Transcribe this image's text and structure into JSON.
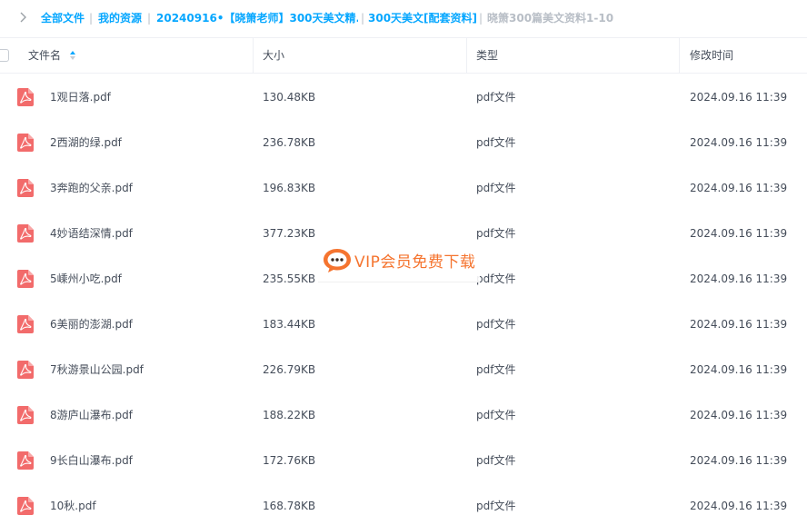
{
  "breadcrumb": {
    "items": [
      "全部文件",
      "我的资源",
      "20240916•【晓箫老师】300天美文精...",
      "300天美文[配套资料]"
    ],
    "current": "晓箫300篇美文资料1-10",
    "separator": "|"
  },
  "table": {
    "headers": {
      "name": "文件名",
      "size": "大小",
      "type": "类型",
      "modified": "修改时间"
    },
    "rows": [
      {
        "name": "1观日落.pdf",
        "size": "130.48KB",
        "type": "pdf文件",
        "modified": "2024.09.16 11:39"
      },
      {
        "name": "2西湖的绿.pdf",
        "size": "236.78KB",
        "type": "pdf文件",
        "modified": "2024.09.16 11:39"
      },
      {
        "name": "3奔跑的父亲.pdf",
        "size": "196.83KB",
        "type": "pdf文件",
        "modified": "2024.09.16 11:39"
      },
      {
        "name": "4妙语结深情.pdf",
        "size": "377.23KB",
        "type": "pdf文件",
        "modified": "2024.09.16 11:39"
      },
      {
        "name": "5嵊州小吃.pdf",
        "size": "235.55KB",
        "type": "pdf文件",
        "modified": "2024.09.16 11:39"
      },
      {
        "name": "6美丽的澎湖.pdf",
        "size": "183.44KB",
        "type": "pdf文件",
        "modified": "2024.09.16 11:39"
      },
      {
        "name": "7秋游景山公园.pdf",
        "size": "226.79KB",
        "type": "pdf文件",
        "modified": "2024.09.16 11:39"
      },
      {
        "name": "8游庐山瀑布.pdf",
        "size": "188.22KB",
        "type": "pdf文件",
        "modified": "2024.09.16 11:39"
      },
      {
        "name": "9长白山瀑布.pdf",
        "size": "172.76KB",
        "type": "pdf文件",
        "modified": "2024.09.16 11:39"
      },
      {
        "name": "10秋.pdf",
        "size": "168.78KB",
        "type": "pdf文件",
        "modified": "2024.09.16 11:39"
      }
    ]
  },
  "watermark": {
    "text": "VIP会员免费下载"
  },
  "colors": {
    "link": "#06a7ff",
    "text": "#454d5a",
    "muted": "#b8bec6",
    "pdf_icon": "#f26b6b",
    "watermark": "#f5742f"
  },
  "icons": {
    "back": "chevron-right-icon",
    "sort": "sort-ascending-icon",
    "file": "pdf-file-icon",
    "watermark": "chat-bubble-icon"
  }
}
